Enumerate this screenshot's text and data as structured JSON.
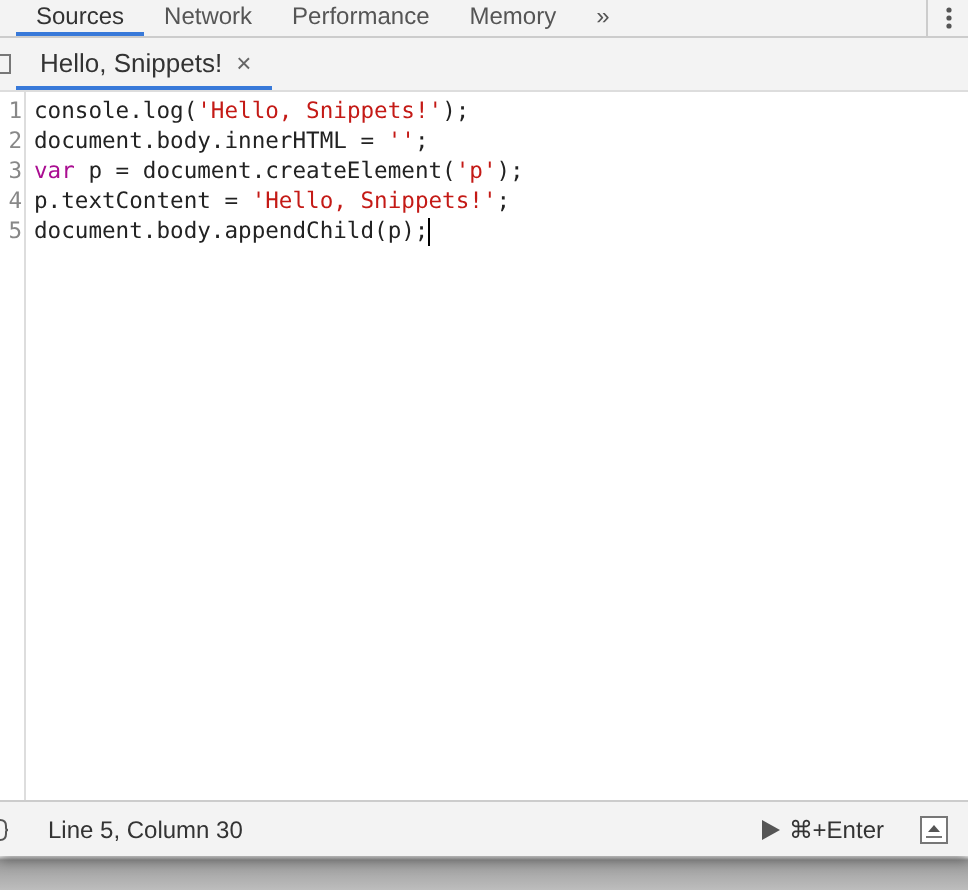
{
  "panel_tabs": [
    {
      "label": "Sources",
      "selected": true
    },
    {
      "label": "Network",
      "selected": false
    },
    {
      "label": "Performance",
      "selected": false
    },
    {
      "label": "Memory",
      "selected": false
    },
    {
      "label": "»",
      "selected": false
    }
  ],
  "editor_tabs": [
    {
      "label": "Hello, Snippets!",
      "selected": true,
      "close": "×"
    }
  ],
  "code_lines": [
    {
      "number": "1",
      "tokens": [
        {
          "kind": "plain",
          "text": "console.log("
        },
        {
          "kind": "string",
          "text": "'Hello, Snippets!'"
        },
        {
          "kind": "plain",
          "text": ");"
        }
      ]
    },
    {
      "number": "2",
      "tokens": [
        {
          "kind": "plain",
          "text": "document.body.innerHTML = "
        },
        {
          "kind": "string",
          "text": "''"
        },
        {
          "kind": "plain",
          "text": ";"
        }
      ]
    },
    {
      "number": "3",
      "tokens": [
        {
          "kind": "keyword",
          "text": "var"
        },
        {
          "kind": "plain",
          "text": " p = document.createElement("
        },
        {
          "kind": "string",
          "text": "'p'"
        },
        {
          "kind": "plain",
          "text": ");"
        }
      ]
    },
    {
      "number": "4",
      "tokens": [
        {
          "kind": "plain",
          "text": "p.textContent = "
        },
        {
          "kind": "string",
          "text": "'Hello, Snippets!'"
        },
        {
          "kind": "plain",
          "text": ";"
        }
      ]
    },
    {
      "number": "5",
      "tokens": [
        {
          "kind": "plain",
          "text": "document.body.appendChild(p);"
        }
      ],
      "cursor": true
    }
  ],
  "status_bar": {
    "position": "Line 5, Column 30",
    "run_shortcut": "⌘+Enter"
  }
}
